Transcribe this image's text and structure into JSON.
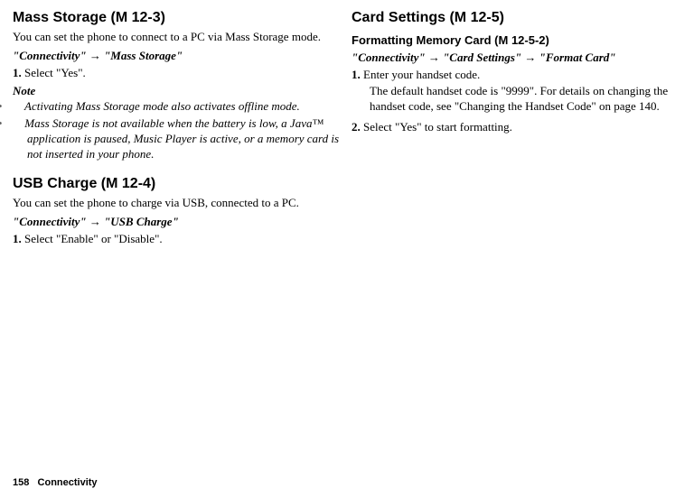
{
  "left": {
    "massStorage": {
      "heading": "Mass Storage (M 12-3)",
      "intro": "You can set the phone to connect to a PC via Mass Storage mode.",
      "path1": "\"Connectivity\"",
      "arrow": "→",
      "path2": "\"Mass Storage\"",
      "step1num": "1.",
      "step1": "Select \"Yes\".",
      "noteHead": "Note",
      "note1": "Activating Mass Storage mode also activates offline mode.",
      "note2": "Mass Storage is not available when the battery is low, a Java™ application is paused, Music Player is active, or a memory card is not inserted in your phone."
    },
    "usbCharge": {
      "heading": "USB Charge (M 12-4)",
      "intro": "You can set the phone to charge via USB, connected to a PC.",
      "path1": "\"Connectivity\"",
      "arrow": "→",
      "path2": "\"USB Charge\"",
      "step1num": "1.",
      "step1": "Select \"Enable\" or \"Disable\"."
    }
  },
  "right": {
    "cardSettings": {
      "heading": "Card Settings (M 12-5)",
      "subheading": "Formatting Memory Card (M 12-5-2)",
      "path1": "\"Connectivity\"",
      "arrow1": "→",
      "path2": "\"Card Settings\"",
      "arrow2": "→",
      "path3": "\"Format Card\"",
      "step1num": "1.",
      "step1": "Enter your handset code.",
      "step1body": "The default handset code is \"9999\". For details on changing the handset code, see \"Changing the Handset Code\" on page 140.",
      "step2num": "2.",
      "step2": "Select \"Yes\" to start formatting."
    }
  },
  "footer": {
    "pageNum": "158",
    "section": "Connectivity"
  },
  "bullet": "•"
}
